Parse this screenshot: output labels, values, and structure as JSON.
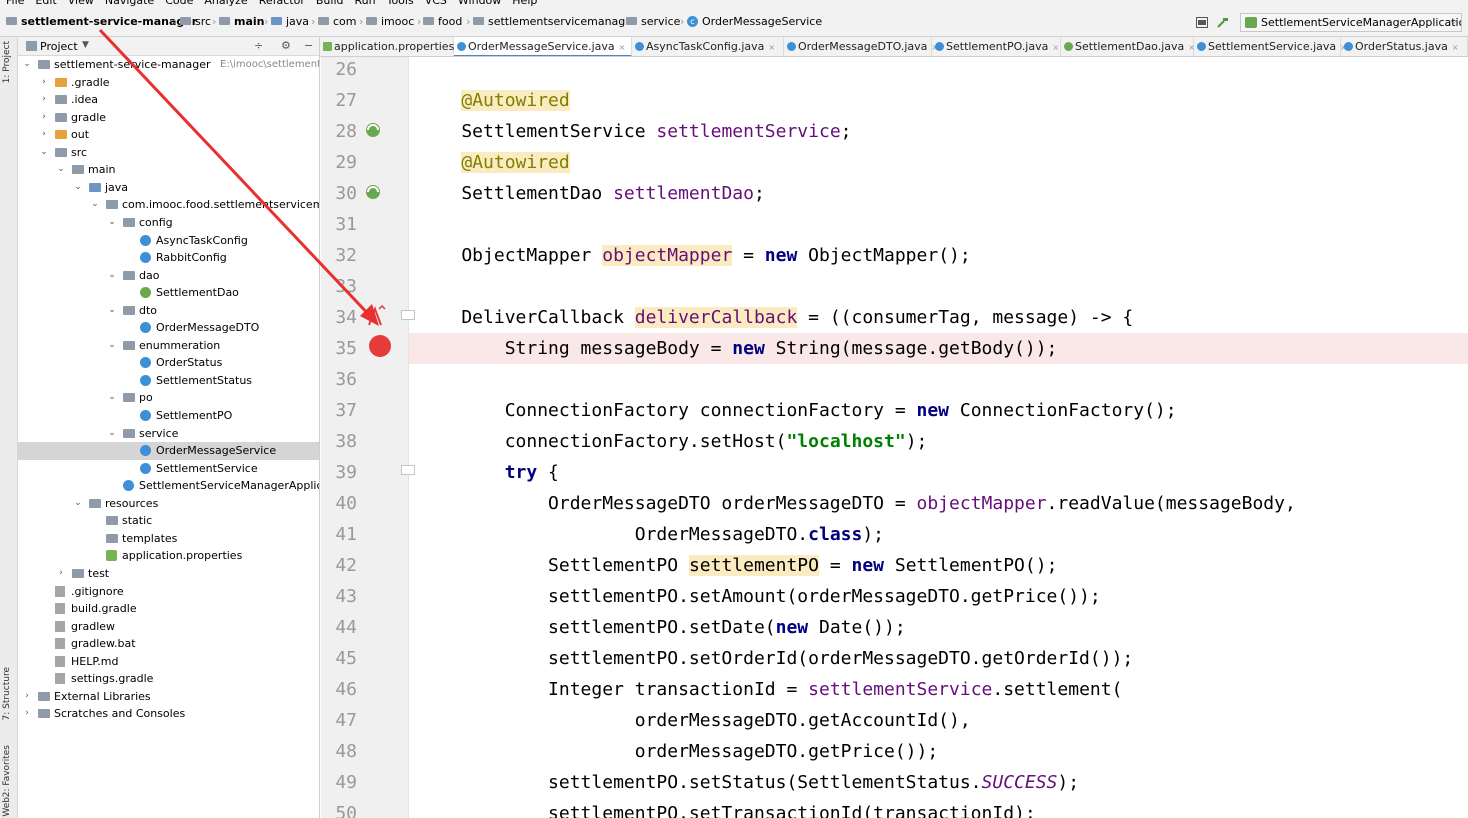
{
  "menu": [
    "File",
    "Edit",
    "View",
    "Navigate",
    "Code",
    "Analyze",
    "Refactor",
    "Build",
    "Run",
    "Tools",
    "VCS",
    "Window",
    "Help"
  ],
  "breadcrumbs": [
    "settlement-service-manager",
    "src",
    "main",
    "java",
    "com",
    "imooc",
    "food",
    "settlementservicemanager",
    "service",
    "OrderMessageService"
  ],
  "run_config": "SettlementServiceManagerApplication",
  "left_strip": {
    "project": "1: Project",
    "structure": "7: Structure",
    "favorites": "2: Favorites",
    "web": "Web"
  },
  "project_panel": {
    "title": "Project",
    "tree": [
      {
        "label": "settlement-service-manager",
        "path": "E:\\imooc\\settlement-servic",
        "arrow": "expanded",
        "icon": "folder"
      },
      {
        "label": ".gradle",
        "arrow": "collapsed",
        "icon": "excl"
      },
      {
        "label": ".idea",
        "arrow": "collapsed",
        "icon": "folder"
      },
      {
        "label": "gradle",
        "arrow": "collapsed",
        "icon": "folder"
      },
      {
        "label": "out",
        "arrow": "collapsed",
        "icon": "excl"
      },
      {
        "label": "src",
        "arrow": "expanded",
        "icon": "folder"
      },
      {
        "label": "main",
        "arrow": "expanded",
        "icon": "folder"
      },
      {
        "label": "java",
        "arrow": "expanded",
        "icon": "src"
      },
      {
        "label": "com.imooc.food.settlementservicemanage",
        "arrow": "expanded",
        "icon": "folder"
      },
      {
        "label": "config",
        "arrow": "expanded",
        "icon": "folder"
      },
      {
        "label": "AsyncTaskConfig",
        "arrow": "",
        "icon": "cls"
      },
      {
        "label": "RabbitConfig",
        "arrow": "",
        "icon": "cls"
      },
      {
        "label": "dao",
        "arrow": "expanded",
        "icon": "folder"
      },
      {
        "label": "SettlementDao",
        "arrow": "",
        "icon": "intf"
      },
      {
        "label": "dto",
        "arrow": "expanded",
        "icon": "folder"
      },
      {
        "label": "OrderMessageDTO",
        "arrow": "",
        "icon": "cls"
      },
      {
        "label": "enummeration",
        "arrow": "expanded",
        "icon": "folder"
      },
      {
        "label": "OrderStatus",
        "arrow": "",
        "icon": "cls"
      },
      {
        "label": "SettlementStatus",
        "arrow": "",
        "icon": "cls"
      },
      {
        "label": "po",
        "arrow": "expanded",
        "icon": "folder"
      },
      {
        "label": "SettlementPO",
        "arrow": "",
        "icon": "cls"
      },
      {
        "label": "service",
        "arrow": "expanded",
        "icon": "folder"
      },
      {
        "label": "OrderMessageService",
        "arrow": "",
        "icon": "cls",
        "selected": true
      },
      {
        "label": "SettlementService",
        "arrow": "",
        "icon": "cls"
      },
      {
        "label": "SettlementServiceManagerApplication",
        "arrow": "",
        "icon": "cls"
      },
      {
        "label": "resources",
        "arrow": "expanded",
        "icon": "folder"
      },
      {
        "label": "static",
        "arrow": "",
        "icon": "folder"
      },
      {
        "label": "templates",
        "arrow": "",
        "icon": "folder"
      },
      {
        "label": "application.properties",
        "arrow": "",
        "icon": "sprg"
      },
      {
        "label": "test",
        "arrow": "collapsed",
        "icon": "folder"
      },
      {
        "label": ".gitignore",
        "arrow": "",
        "icon": "file"
      },
      {
        "label": "build.gradle",
        "arrow": "",
        "icon": "file"
      },
      {
        "label": "gradlew",
        "arrow": "",
        "icon": "file"
      },
      {
        "label": "gradlew.bat",
        "arrow": "",
        "icon": "file"
      },
      {
        "label": "HELP.md",
        "arrow": "",
        "icon": "file"
      },
      {
        "label": "settings.gradle",
        "arrow": "",
        "icon": "file"
      },
      {
        "label": "External Libraries",
        "arrow": "collapsed",
        "icon": "folder"
      },
      {
        "label": "Scratches and Consoles",
        "arrow": "collapsed",
        "icon": "folder"
      }
    ]
  },
  "editor_tabs": [
    {
      "label": "application.properties",
      "icon": "sprg"
    },
    {
      "label": "OrderMessageService.java",
      "icon": "cls",
      "active": true
    },
    {
      "label": "AsyncTaskConfig.java",
      "icon": "cls"
    },
    {
      "label": "OrderMessageDTO.java",
      "icon": "cls"
    },
    {
      "label": "SettlementPO.java",
      "icon": "cls"
    },
    {
      "label": "SettlementDao.java",
      "icon": "intf"
    },
    {
      "label": "SettlementService.java",
      "icon": "cls"
    },
    {
      "label": "OrderStatus.java",
      "icon": "cls"
    }
  ],
  "code": {
    "breakpoint_line": 35,
    "lines": [
      {
        "n": "26",
        "html": ""
      },
      {
        "n": "27",
        "html": "    <span class=\"hl-ann\">@Autowired</span>"
      },
      {
        "n": "28",
        "html": "    SettlementService <span class=\"fld\">settlementService</span>;"
      },
      {
        "n": "29",
        "html": "    <span class=\"hl-ann\">@Autowired</span>"
      },
      {
        "n": "30",
        "html": "    SettlementDao <span class=\"fld\">settlementDao</span>;"
      },
      {
        "n": "31",
        "html": ""
      },
      {
        "n": "32",
        "html": "    ObjectMapper <span class=\"fld hl\">objectMapper</span> = <span class=\"kw\">new</span> ObjectMapper();"
      },
      {
        "n": "33",
        "html": ""
      },
      {
        "n": "34",
        "html": "    DeliverCallback <span class=\"fld hl\">deliverCallback</span> = ((consumerTag, message) -> {"
      },
      {
        "n": "35",
        "html": "        String messageBody = <span class=\"kw\">new</span> String(message.getBody());"
      },
      {
        "n": "36",
        "html": ""
      },
      {
        "n": "37",
        "html": "        ConnectionFactory connectionFactory = <span class=\"kw\">new</span> ConnectionFactory();"
      },
      {
        "n": "38",
        "html": "        connectionFactory.setHost(<span class=\"str\">\"localhost\"</span>);"
      },
      {
        "n": "39",
        "html": "        <span class=\"kw\">try</span> {"
      },
      {
        "n": "40",
        "html": "            OrderMessageDTO orderMessageDTO = <span class=\"fld\">objectMapper</span>.readValue(messageBody,"
      },
      {
        "n": "41",
        "html": "                    OrderMessageDTO.<span class=\"kw\">class</span>);"
      },
      {
        "n": "42",
        "html": "            SettlementPO <span class=\"hl\">settlementPO</span> = <span class=\"kw\">new</span> SettlementPO();"
      },
      {
        "n": "43",
        "html": "            settlementPO.setAmount(orderMessageDTO.getPrice());"
      },
      {
        "n": "44",
        "html": "            settlementPO.setDate(<span class=\"kw\">new</span> Date());"
      },
      {
        "n": "45",
        "html": "            settlementPO.setOrderId(orderMessageDTO.getOrderId());"
      },
      {
        "n": "46",
        "html": "            Integer transactionId = <span class=\"fld\">settlementService</span>.settlement("
      },
      {
        "n": "47",
        "html": "                    orderMessageDTO.getAccountId(),"
      },
      {
        "n": "48",
        "html": "                    orderMessageDTO.getPrice());"
      },
      {
        "n": "49",
        "html": "            settlementPO.setStatus(SettlementStatus.<span class=\"stat\">SUCCESS</span>);"
      },
      {
        "n": "50",
        "html": "            settlementPO.setTransactionId(transactionId);"
      }
    ]
  },
  "colors": {
    "breakpoint": "#e53b3b",
    "annotation_arrow": "#e8302f",
    "keyword": "#000080",
    "field": "#660e7a",
    "string": "#008000"
  }
}
